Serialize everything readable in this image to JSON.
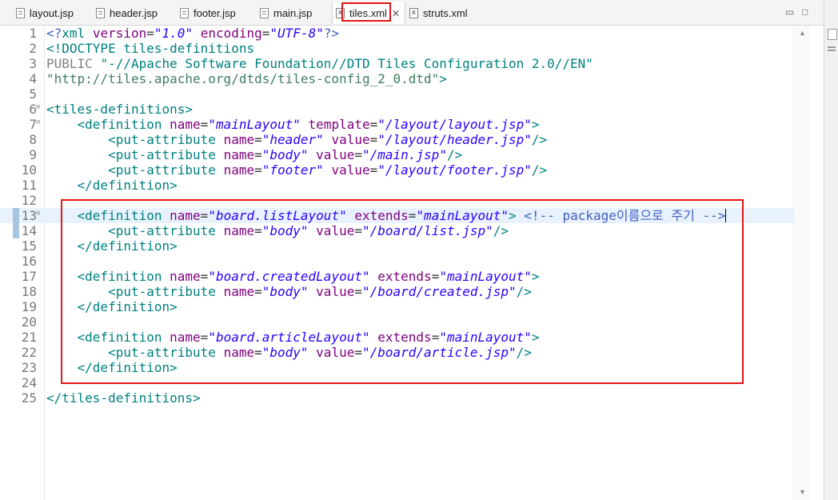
{
  "tabs": [
    {
      "label": "layout.jsp",
      "icon": "jsp-file-icon"
    },
    {
      "label": "header.jsp",
      "icon": "jsp-file-icon"
    },
    {
      "label": "footer.jsp",
      "icon": "jsp-file-icon"
    },
    {
      "label": "main.jsp",
      "icon": "jsp-file-icon"
    },
    {
      "label": "tiles.xml",
      "icon": "xml-file-icon",
      "active": true,
      "close": "✕"
    },
    {
      "label": "struts.xml",
      "icon": "xml-file-icon"
    }
  ],
  "window_controls": {
    "minimize": "▭",
    "maximize": "□"
  },
  "editor": {
    "lines": [
      {
        "n": "1"
      },
      {
        "n": "2"
      },
      {
        "n": "3"
      },
      {
        "n": "4"
      },
      {
        "n": "5"
      },
      {
        "n": "6",
        "fold": "⊖"
      },
      {
        "n": "7",
        "fold": "⊖"
      },
      {
        "n": "8"
      },
      {
        "n": "9"
      },
      {
        "n": "10"
      },
      {
        "n": "11"
      },
      {
        "n": "12"
      },
      {
        "n": "13",
        "fold": "⊖"
      },
      {
        "n": "14"
      },
      {
        "n": "15"
      },
      {
        "n": "16"
      },
      {
        "n": "17"
      },
      {
        "n": "18"
      },
      {
        "n": "19"
      },
      {
        "n": "20"
      },
      {
        "n": "21"
      },
      {
        "n": "22"
      },
      {
        "n": "23"
      },
      {
        "n": "24"
      },
      {
        "n": "25"
      }
    ],
    "comment_text": "<!-- package이름으로 주기 -->"
  },
  "highlight_color": "#e81414"
}
